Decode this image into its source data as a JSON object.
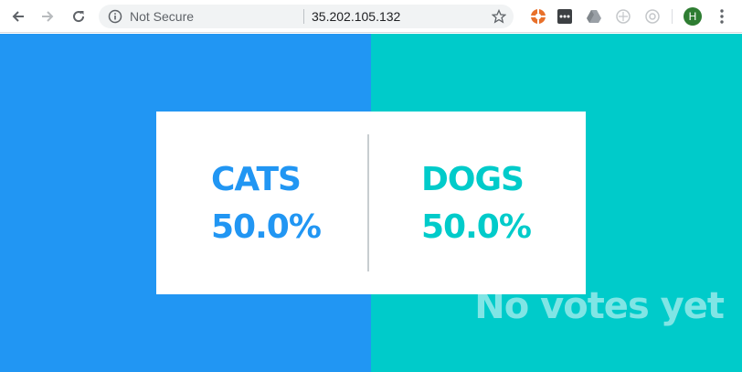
{
  "browser": {
    "security_label": "Not Secure",
    "url": "35.202.105.132",
    "profile_initial": "H"
  },
  "icons": {
    "back": "arrow-left-icon",
    "forward": "arrow-right-icon",
    "reload": "reload-icon",
    "info": "info-icon",
    "bookmark": "star-icon",
    "menu": "kebab-menu-icon"
  },
  "colors": {
    "cats": "#2196f3",
    "dogs": "#00cbca",
    "card": "#ffffff"
  },
  "vote": {
    "cats_label": "CATS",
    "cats_percent": "50.0%",
    "dogs_label": "DOGS",
    "dogs_percent": "50.0%",
    "status": "No votes yet"
  }
}
